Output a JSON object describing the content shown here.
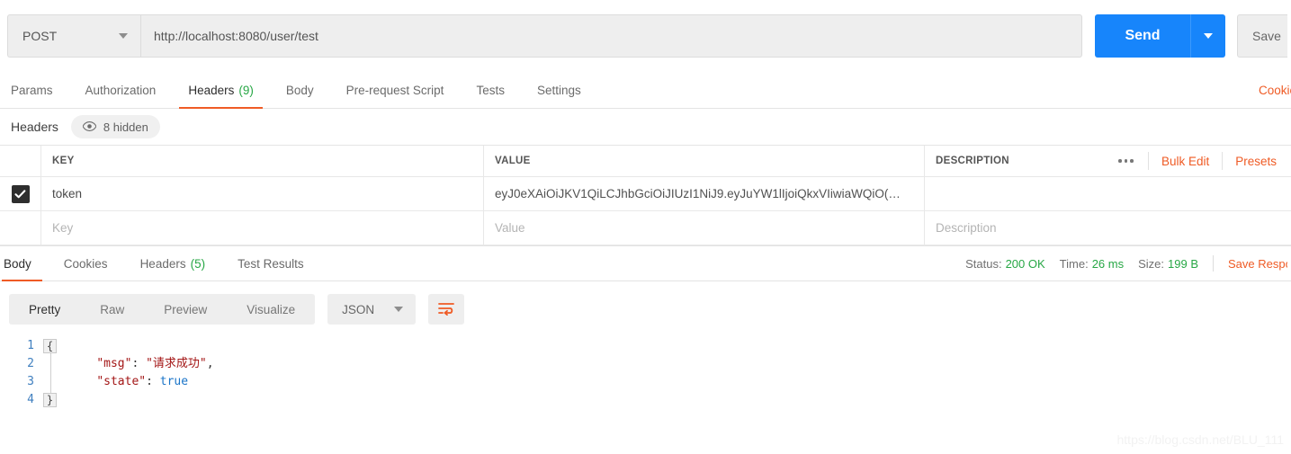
{
  "request": {
    "method": "POST",
    "url": "http://localhost:8080/user/test",
    "send_label": "Send",
    "save_label": "Save",
    "tabs": [
      {
        "label": "Params",
        "count": "",
        "active": false
      },
      {
        "label": "Authorization",
        "count": "",
        "active": false
      },
      {
        "label": "Headers",
        "count": "(9)",
        "active": true
      },
      {
        "label": "Body",
        "count": "",
        "active": false
      },
      {
        "label": "Pre-request Script",
        "count": "",
        "active": false
      },
      {
        "label": "Tests",
        "count": "",
        "active": false
      },
      {
        "label": "Settings",
        "count": "",
        "active": false
      }
    ],
    "cookies_link": "Cookies"
  },
  "headers_panel": {
    "title": "Headers",
    "hidden_pill": "8 hidden",
    "columns": {
      "key": "KEY",
      "value": "VALUE",
      "description": "DESCRIPTION"
    },
    "actions": {
      "bulk_edit": "Bulk Edit",
      "presets": "Presets"
    },
    "rows": [
      {
        "checked": true,
        "key": "token",
        "value": "eyJ0eXAiOiJKV1QiLCJhbGciOiJIUzI1NiJ9.eyJuYW1lIjoiQkxVIiwiaWQiO(…",
        "description": ""
      }
    ],
    "empty_row": {
      "key_placeholder": "Key",
      "value_placeholder": "Value",
      "description_placeholder": "Description"
    }
  },
  "response": {
    "tabs": [
      {
        "label": "Body",
        "count": "",
        "active": true
      },
      {
        "label": "Cookies",
        "count": "",
        "active": false
      },
      {
        "label": "Headers",
        "count": "(5)",
        "active": false
      },
      {
        "label": "Test Results",
        "count": "",
        "active": false
      }
    ],
    "status": {
      "status_label": "Status:",
      "status_value": "200 OK",
      "time_label": "Time:",
      "time_value": "26 ms",
      "size_label": "Size:",
      "size_value": "199 B"
    },
    "save_response": "Save Response",
    "view_modes": [
      {
        "label": "Pretty",
        "active": true
      },
      {
        "label": "Raw",
        "active": false
      },
      {
        "label": "Preview",
        "active": false
      },
      {
        "label": "Visualize",
        "active": false
      }
    ],
    "format": "JSON",
    "body": {
      "line_numbers": [
        "1",
        "2",
        "3",
        "4"
      ],
      "lines": [
        {
          "open_brace": "{"
        },
        {
          "indent": "    ",
          "key": "\"msg\"",
          "colon": ": ",
          "value": "\"请求成功\"",
          "comma": ","
        },
        {
          "indent": "    ",
          "key": "\"state\"",
          "colon": ": ",
          "value": "true",
          "comma": ""
        },
        {
          "close_brace": "}"
        }
      ]
    }
  },
  "watermark": "https://blog.csdn.net/BLU_111",
  "colors": {
    "accent_orange": "#ef5b25",
    "send_blue": "#1785fb",
    "status_green": "#27a745"
  }
}
